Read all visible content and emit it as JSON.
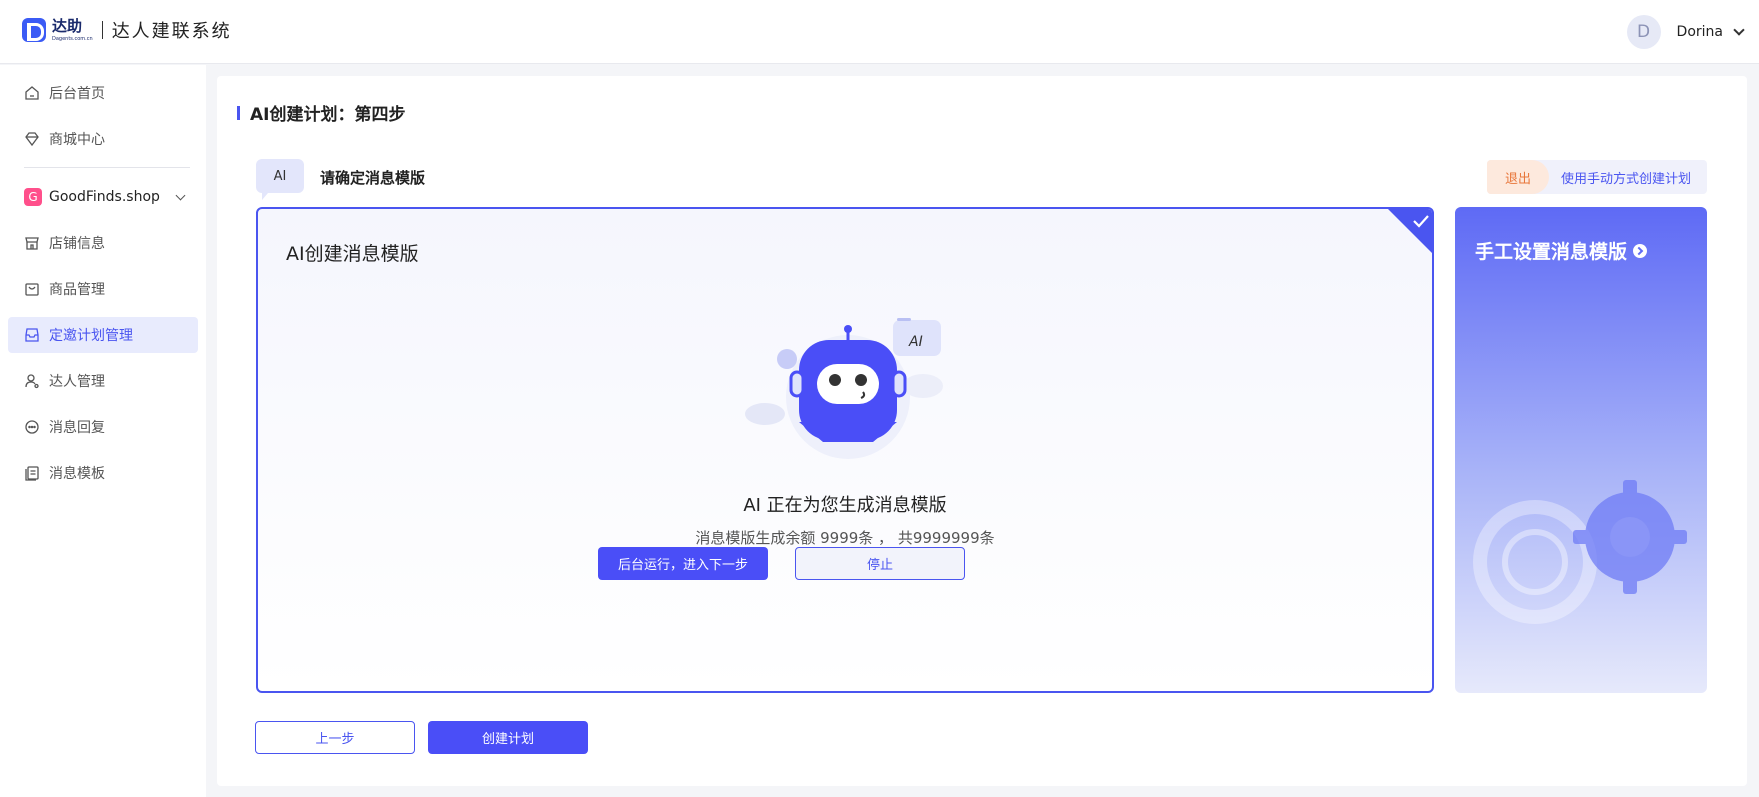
{
  "header": {
    "logo_cn": "达助",
    "logo_en": "Dagents.com.cn",
    "system_title": "达人建联系统",
    "user_initial": "D",
    "user_name": "Dorina"
  },
  "sidebar": {
    "items": [
      {
        "label": "后台首页",
        "icon": "home-icon"
      },
      {
        "label": "商城中心",
        "icon": "diamond-icon"
      }
    ],
    "shop": {
      "badge": "G",
      "name": "GoodFinds.shop"
    },
    "shop_items": [
      {
        "label": "店铺信息",
        "icon": "store-icon",
        "active": false
      },
      {
        "label": "商品管理",
        "icon": "bag-icon",
        "active": false
      },
      {
        "label": "定邀计划管理",
        "icon": "inbox-icon",
        "active": true
      },
      {
        "label": "达人管理",
        "icon": "user-icon",
        "active": false
      },
      {
        "label": "消息回复",
        "icon": "chat-icon",
        "active": false
      },
      {
        "label": "消息模板",
        "icon": "document-icon",
        "active": false
      }
    ]
  },
  "main": {
    "page_title": "AI创建计划：第四步",
    "ai_badge": "AI",
    "step_label": "请确定消息模版",
    "exit_label": "退出",
    "manual_link": "使用手动方式创建计划",
    "ai_card": {
      "title": "AI创建消息模版",
      "robot_badge": "AI",
      "status": "AI 正在为您生成消息模版",
      "quota": "消息模版生成余额 9999条 ， 共9999999条",
      "background_button": "后台运行，进入下一步",
      "stop_button": "停止"
    },
    "manual_card": {
      "title": "手工设置消息模版"
    },
    "prev_button": "上一步",
    "create_button": "创建计划"
  },
  "colors": {
    "accent": "#4a55f0",
    "primary_button": "#4a4ef7",
    "exit_text": "#e8763a",
    "shop_badge": "#ff4f8b"
  }
}
